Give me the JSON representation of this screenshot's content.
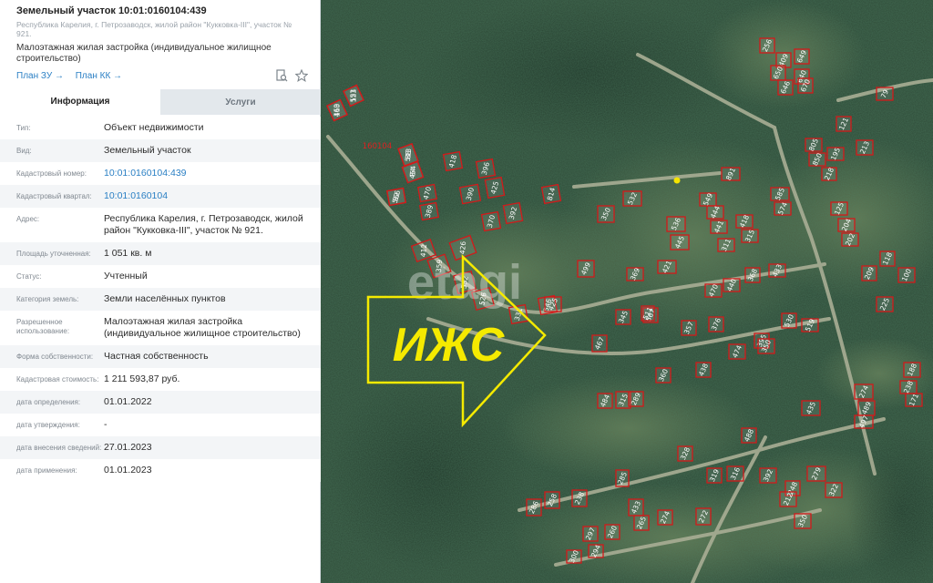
{
  "panel": {
    "title": "Земельный участок 10:01:0160104:439",
    "address_line": "Республика Карелия, г. Петрозаводск, жилой район \"Кукковка-III\", участок № 921.",
    "usage_line": "Малоэтажная жилая застройка (индивидуальное жилищное строительство)",
    "links": [
      "План ЗУ →",
      "План КК →"
    ],
    "icons": [
      "search-doc-icon",
      "star-icon"
    ],
    "tabs": [
      "Информация",
      "Услуги"
    ],
    "active_tab": "Информация",
    "rows": [
      {
        "label": "Тип:",
        "value": "Объект недвижимости"
      },
      {
        "label": "Вид:",
        "value": "Земельный участок"
      },
      {
        "label": "Кадастровый номер:",
        "value": "10:01:0160104:439",
        "link": true
      },
      {
        "label": "Кадастровый квартал:",
        "value": "10:01:0160104",
        "link": true
      },
      {
        "label": "Адрес:",
        "value": "Республика Карелия, г. Петрозаводск, жилой район \"Кукковка-III\", участок № 921."
      },
      {
        "label": "Площадь уточненная:",
        "value": "1 051 кв. м"
      },
      {
        "label": "Статус:",
        "value": "Учтенный"
      },
      {
        "label": "Категория земель:",
        "value": "Земли населённых пунктов"
      },
      {
        "label": "Разрешенное использование:",
        "value": "Малоэтажная жилая застройка (индивидуальное жилищное строительство)"
      },
      {
        "label": "Форма собственности:",
        "value": "Частная собственность"
      },
      {
        "label": "Кадастровая стоимость:",
        "value": "1 211 593,87 руб."
      },
      {
        "label": "дата определения:",
        "value": "01.01.2022"
      },
      {
        "label": "дата утверждения:",
        "value": "-"
      },
      {
        "label": "дата внесения сведений:",
        "value": "27.01.2023"
      },
      {
        "label": "дата применения:",
        "value": "01.01.2023"
      }
    ]
  },
  "map": {
    "block_label": "160104",
    "overlay_text": "ИЖС",
    "watermark": "etagi",
    "colors": {
      "parcel_border": "#d21a1a",
      "arrow": "#f5ea00",
      "selected_parcel": "#f5e400",
      "forest": "#2f4b38"
    },
    "selected_parcel": "439",
    "parcel_labels": [
      "460",
      "553",
      "513",
      "454",
      "566",
      "470",
      "389",
      "418",
      "396",
      "390",
      "425",
      "392",
      "370",
      "814",
      "532",
      "350",
      "891",
      "549",
      "585",
      "574",
      "536",
      "444",
      "445",
      "441",
      "418",
      "315",
      "311",
      "421",
      "412",
      "359",
      "426",
      "532",
      "526",
      "331",
      "546",
      "425",
      "499",
      "369",
      "345",
      "567",
      "470",
      "440",
      "368",
      "433",
      "511",
      "357",
      "376",
      "395",
      "519",
      "530",
      "474",
      "350",
      "360",
      "438",
      "467",
      "315",
      "289",
      "484",
      "435",
      "274",
      "489",
      "497",
      "488",
      "328",
      "316",
      "319",
      "392",
      "279",
      "248",
      "322",
      "212",
      "350",
      "285",
      "433",
      "297",
      "300",
      "294",
      "260",
      "265",
      "274",
      "272",
      "286",
      "258",
      "238",
      "256",
      "409",
      "650",
      "649",
      "640",
      "646",
      "670",
      "805",
      "850",
      "195",
      "218",
      "213",
      "79",
      "121",
      "125",
      "204",
      "202",
      "225",
      "238",
      "188",
      "171",
      "118",
      "209",
      "100",
      "113",
      "121",
      "88",
      "84",
      "82"
    ]
  }
}
